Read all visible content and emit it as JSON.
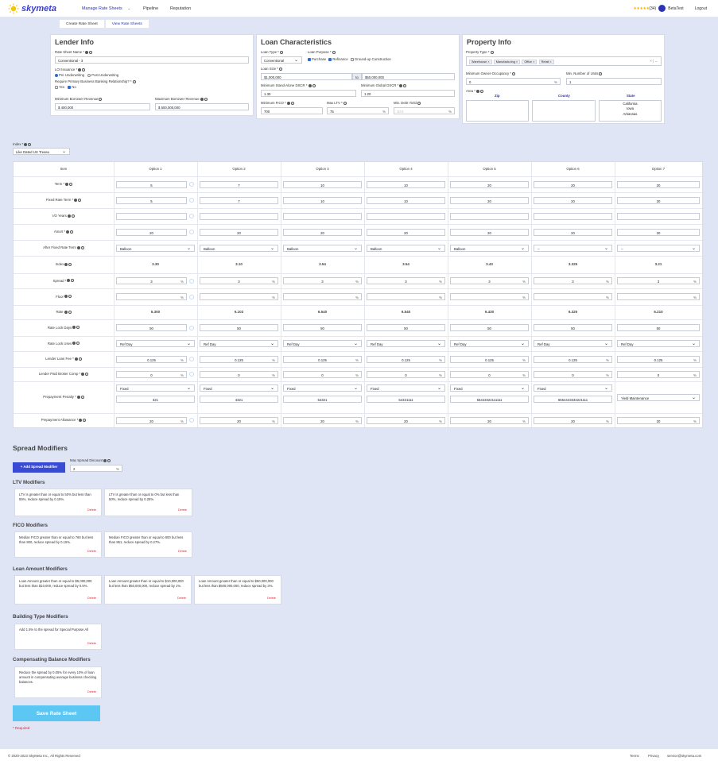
{
  "header": {
    "brand": "skymeta",
    "nav": [
      "Manage Rate Sheets",
      "Pipeline",
      "Reputation"
    ],
    "stars": "★★★★★",
    "rating_count": "(34)",
    "user": "BetaTest",
    "logout": "Logout"
  },
  "tabs": [
    "Create Rate Sheet",
    "View Rate Sheets"
  ],
  "lender": {
    "title": "Lender Info",
    "rate_sheet_name_label": "Rate Sheet Name *",
    "rate_sheet_name": "Conventional - 3",
    "loi_label": "LOI Issuance *",
    "loi_opt1": "Pre Underwriting",
    "loi_opt2": "Post Underwriting",
    "banking_label": "Require Primary Business Banking Relationship? *",
    "yes": "Yes",
    "no": "No",
    "min_rev_label": "Minimum Borrower Revenue",
    "min_rev": "$ 400,000",
    "max_rev_label": "Maximum Borrower Revenue",
    "max_rev": "$ 500,000,000"
  },
  "loan": {
    "title": "Loan Characteristics",
    "type_label": "Loan Type *",
    "type": "Conventional",
    "purpose_label": "Loan Purpose *",
    "purpose_opts": [
      "Purchase",
      "Refinance",
      "Ground-up Construction"
    ],
    "size_label": "Loan Size *",
    "size_min": "$1,000,000",
    "to": "to",
    "size_max": "$50,000,000",
    "dscr_label": "Minimum Stand-Alone DSCR *",
    "dscr": "1.30",
    "global_label": "Minimum Global DSCR *",
    "global": "1.20",
    "fico_label": "Minimum FICO *",
    "fico": "700",
    "ltv_label": "Max LTV *",
    "ltv": "75",
    "debt_label": "Min. Debt Yield",
    "debt": "10.0"
  },
  "property": {
    "title": "Property Info",
    "type_label": "Property Type *",
    "types": [
      "Warehouse",
      "Manufacturing",
      "Office",
      "Retail"
    ],
    "occ_label": "Minimum Owner-Occupancy *",
    "occ": "0",
    "units_label": "Min. Number of Units",
    "units": "1",
    "area_label": "Area *",
    "zip": "Zip",
    "county": "County",
    "state": "State",
    "states": [
      "California",
      "Iowa",
      "Arkansas"
    ]
  },
  "index": {
    "label": "Index *",
    "value": "Like Dated US Treasu"
  },
  "table": {
    "item_header": "Item",
    "options": [
      "Option 1",
      "Option 2",
      "Option 3",
      "Option 4",
      "Option 5",
      "Option 6",
      "Option 7"
    ],
    "rows": [
      {
        "label": "Term *",
        "vals": [
          "5",
          "7",
          "10",
          "10",
          "20",
          "20",
          "20"
        ]
      },
      {
        "label": "Fixed Rate Term *",
        "vals": [
          "5",
          "7",
          "10",
          "10",
          "20",
          "20",
          "20"
        ]
      },
      {
        "label": "I/O Years",
        "vals": [
          "",
          "",
          "",
          "",
          "",
          "",
          ""
        ]
      },
      {
        "label": "Amort *",
        "vals": [
          "20",
          "20",
          "20",
          "20",
          "20",
          "20",
          "20"
        ]
      },
      {
        "label": "After Fixed Rate Term",
        "vals": [
          "Balloon",
          "Balloon",
          "Balloon",
          "Balloon",
          "Balloon",
          "--",
          "--"
        ]
      },
      {
        "label": "Index",
        "vals": [
          "3.30",
          "3.10",
          "3.54",
          "3.54",
          "3.43",
          "3.325",
          "3.21"
        ]
      },
      {
        "label": "Spread *",
        "vals": [
          "3",
          "3",
          "3",
          "3",
          "3",
          "3",
          "3"
        ]
      },
      {
        "label": "Floor",
        "vals": [
          "",
          "",
          "",
          "",
          "",
          "",
          ""
        ]
      },
      {
        "label": "Rate",
        "vals": [
          "6.300",
          "6.103",
          "6.540",
          "6.540",
          "6.430",
          "6.325",
          "6.210"
        ]
      },
      {
        "label": "Rate Lock Days",
        "vals": [
          "50",
          "50",
          "50",
          "50",
          "50",
          "50",
          "50"
        ]
      },
      {
        "label": "Rate Lock Uses",
        "vals": [
          "Ref Day",
          "Ref Day",
          "Ref Day",
          "Ref Day",
          "Ref Day",
          "Ref Day",
          "Ref Day"
        ]
      },
      {
        "label": "Lender Loan Fee *",
        "vals": [
          "0.125",
          "0.125",
          "0.125",
          "0.125",
          "0.125",
          "0.125",
          "0.125"
        ]
      },
      {
        "label": "Lender Paid Broker Comp *",
        "vals": [
          "0",
          "0",
          "0",
          "0",
          "0",
          "0",
          "0"
        ]
      },
      {
        "label": "Prepayment Penalty *",
        "vals": [
          "Fixed",
          "Fixed",
          "Fixed",
          "Fixed",
          "Fixed",
          "Fixed",
          "Yield Maintenance"
        ],
        "sub": [
          "321",
          "4321",
          "54321",
          "54321111",
          "55443322111111",
          "5554443332221111",
          ""
        ]
      },
      {
        "label": "Prepayment Allowance *",
        "vals": [
          "20",
          "20",
          "20",
          "20",
          "20",
          "20",
          "20"
        ]
      }
    ]
  },
  "modifiers": {
    "title": "Spread Modifiers",
    "add_btn": "+ Add Spread Modifier",
    "max_label": "Max Spread Discount",
    "max_value": "2",
    "delete": "Delete",
    "ltv_title": "LTV Modifiers",
    "ltv_cards": [
      "LTV is greater than or equal to 50% but less than 55%, reduce spread by 0.15%.",
      "LTV is greater than or equal to 0% but less than 50%, reduce spread by 0.25%."
    ],
    "fico_title": "FICO Modifiers",
    "fico_cards": [
      "Median FICO greater than or equal to 760 but less than 800, reduce spread by 0.15%.",
      "Median FICO greater than or equal to 800 but less than 851, reduce spread by 0.27%."
    ],
    "amount_title": "Loan Amount Modifiers",
    "amount_cards": [
      "Loan Amount greater than or equal to $5,000,000 but less than $10,000, reduce spread by 0.5%.",
      "Loan Amount greater than or equal to $10,000,000 but less than $50,000,000, reduce spread by 1%.",
      "Loan Amount greater than or equal to $50,000,000 but less than $500,000,000, reduce spread by 3%."
    ],
    "building_title": "Building Type Modifiers",
    "building_cards": [
      "Add 1.5% to the spread for Special Purpose All"
    ],
    "comp_title": "Compensating Balance Modifiers",
    "comp_cards": [
      "Reduce the spread by 0.05% for every 10% of loan amount in compensating average business checking balances."
    ]
  },
  "save": "Save Rate Sheet",
  "required": "* Required",
  "footer": {
    "copyright": "© 2020-2023 SkyMeta Inc., All Rights Reserved",
    "terms": "Terms",
    "privacy": "Privacy",
    "email": "service@skymeta.com"
  },
  "colors": {
    "accent": "#2b33b5",
    "save": "#5cc7f2",
    "delete": "#dd2233",
    "bg": "#dfe5f5"
  }
}
